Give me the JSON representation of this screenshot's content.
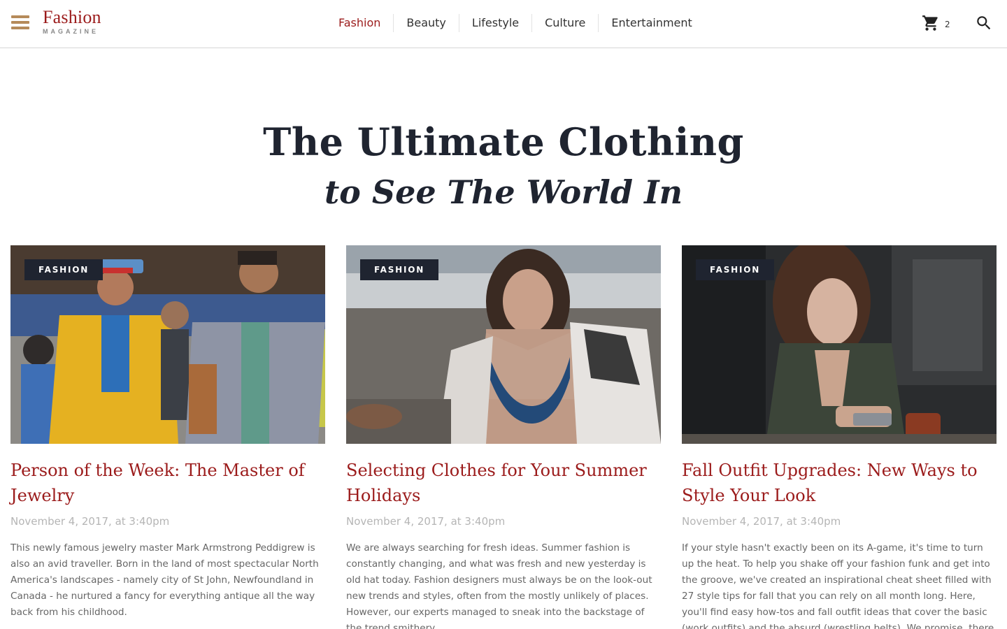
{
  "header": {
    "logo_main": "Fashion",
    "logo_sub": "MAGAZINE",
    "nav": [
      {
        "label": "Fashion",
        "active": true
      },
      {
        "label": "Beauty",
        "active": false
      },
      {
        "label": "Lifestyle",
        "active": false
      },
      {
        "label": "Culture",
        "active": false
      },
      {
        "label": "Entertainment",
        "active": false
      }
    ],
    "cart_count": "2",
    "icons": {
      "menu": "hamburger-icon",
      "cart": "cart-icon",
      "search": "search-icon"
    }
  },
  "hero": {
    "title": "The Ultimate Clothing",
    "subtitle": "to See The World In"
  },
  "colors": {
    "accent": "#9b1b1b",
    "dark": "#1f2430",
    "menu_icon": "#b58a5a",
    "muted_text": "#b5b5b5"
  },
  "articles": [
    {
      "category": "FASHION",
      "title": "Person of the Week: The Master of Jewelry",
      "date": "November 4, 2017, at 3:40pm",
      "excerpt": "This newly famous jewelry master Mark Armstrong Peddigrew is also an avid traveller. Born in the land of most spectacular North America's landscapes - namely city of St John, Newfoundland in Canada - he nurtured a fancy for everything antique all the way back from his childhood."
    },
    {
      "category": "FASHION",
      "title": "Selecting Clothes for Your Summer Holidays",
      "date": "November 4, 2017, at 3:40pm",
      "excerpt": "We are always searching for fresh ideas. Summer fashion is constantly changing, and what was fresh and new yesterday is old hat today. Fashion designers must always be on the look-out new trends and styles, often from the mostly unlikely of places. However, our experts managed to sneak into the backstage of the trend smithery."
    },
    {
      "category": "FASHION",
      "title": "Fall Outfit Upgrades: New Ways to Style Your Look",
      "date": "November 4, 2017, at 3:40pm",
      "excerpt": "If your style hasn't exactly been on its A-game, it's time to turn up the heat. To help you shake off your fashion funk and get into the groove, we've created an inspirational cheat sheet filled with 27 style tips for fall that you can rely on all month long. Here, you'll find easy how-tos and fall outfit ideas that cover the basic (work outfits) and the absurd (wrestling belts). We promise, there are a"
    }
  ]
}
